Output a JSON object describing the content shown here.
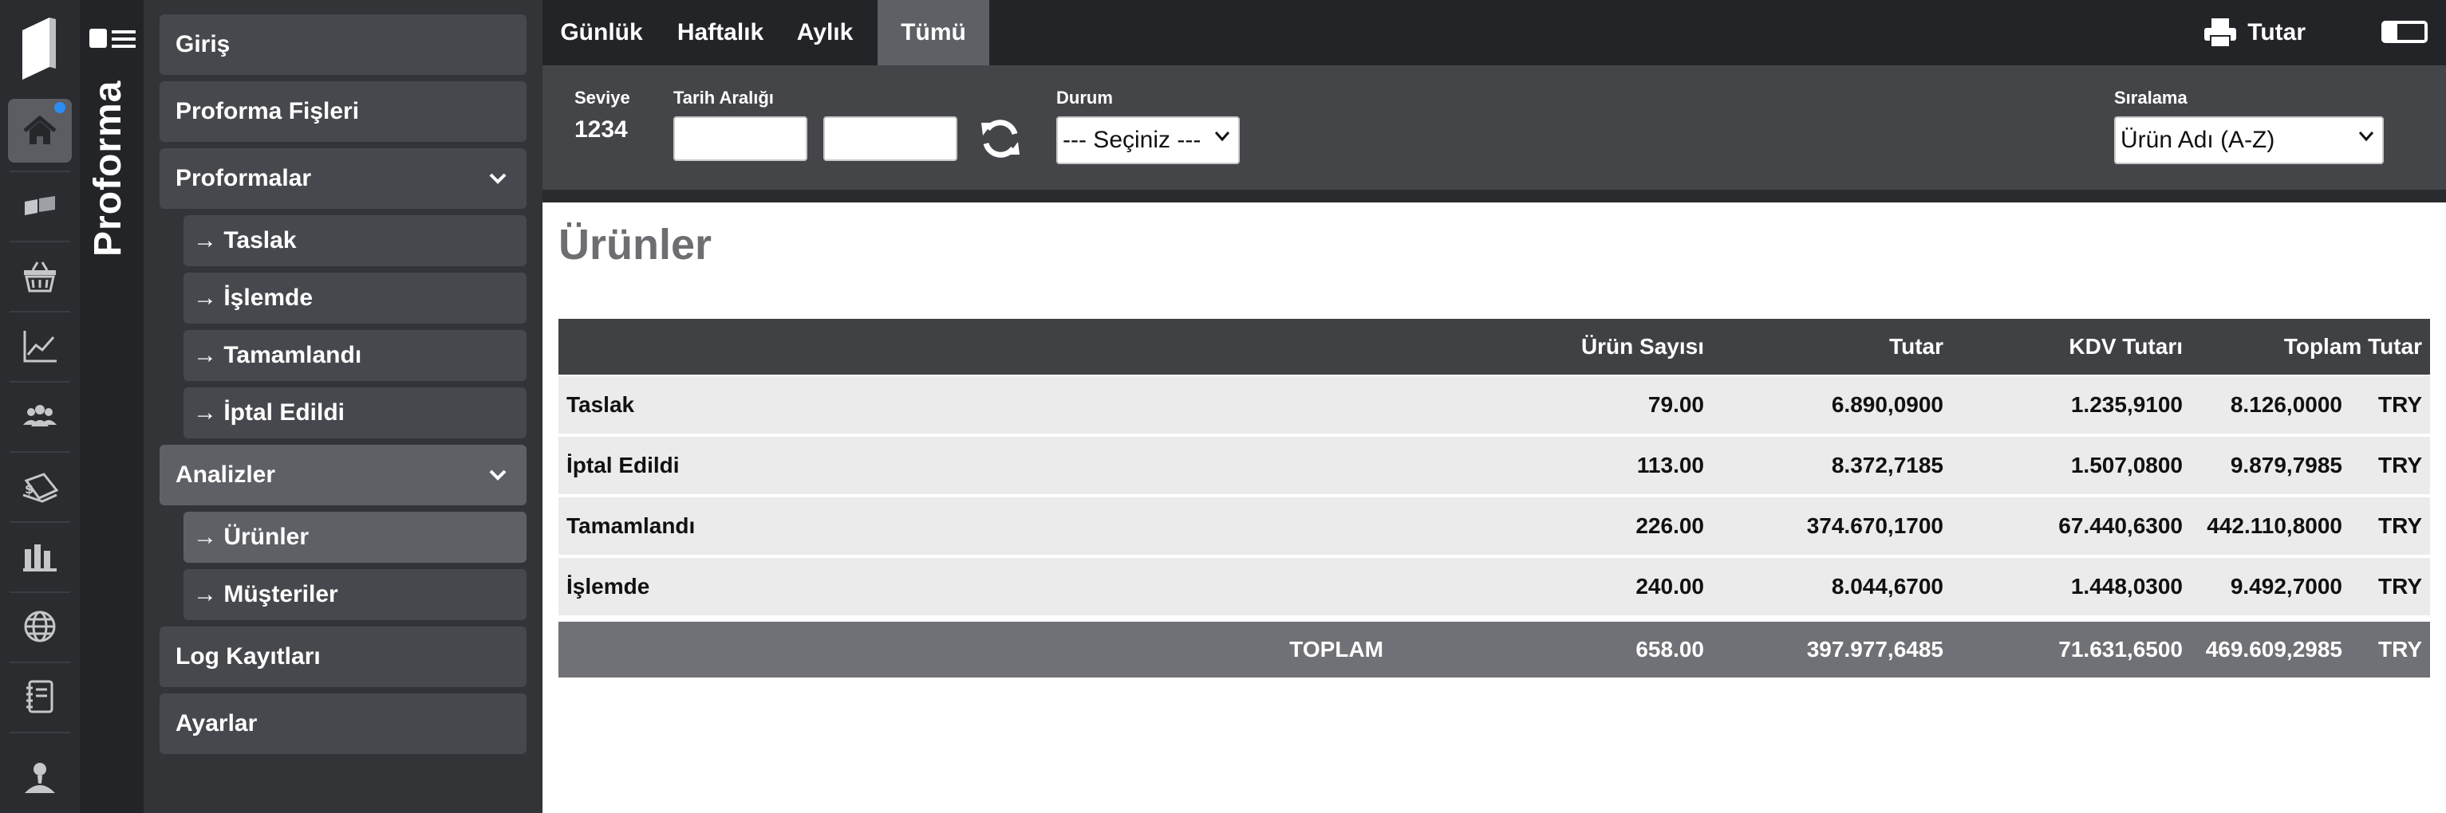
{
  "app": {
    "title": "Proforma",
    "accent_color": "#2d8cf0"
  },
  "rail": {
    "items": [
      {
        "icon": "home-icon",
        "active": true,
        "notification": true
      },
      {
        "icon": "tickets-icon"
      },
      {
        "icon": "basket-icon"
      },
      {
        "icon": "chart-line-icon"
      },
      {
        "icon": "users-group-icon"
      },
      {
        "icon": "money-bill-icon"
      },
      {
        "icon": "warehouse-icon"
      },
      {
        "icon": "globe-icon"
      },
      {
        "icon": "notebook-icon"
      },
      {
        "icon": "user-icon"
      }
    ]
  },
  "sidebar": {
    "home": "Giriş",
    "proforma_slips": "Proforma Fişleri",
    "proformas": "Proformalar",
    "draft": "→ Taslak",
    "in_process": "→ İşlemde",
    "completed": "→ Tamamlandı",
    "cancelled": "→ İptal Edildi",
    "analyses": "Analizler",
    "products": "→ Ürünler",
    "customers": "→ Müşteriler",
    "logs": "Log Kayıtları",
    "settings": "Ayarlar"
  },
  "tabs": {
    "daily": "Günlük",
    "weekly": "Haftalık",
    "monthly": "Aylık",
    "all": "Tümü",
    "active": "Tümü"
  },
  "toolbar": {
    "print_label": "Tutar"
  },
  "filters": {
    "level_label": "Seviye",
    "level_value": "1234",
    "date_range_label": "Tarih Aralığı",
    "date_from": "",
    "date_to": "",
    "status_label": "Durum",
    "status_value": "--- Seçiniz ---",
    "sort_label": "Sıralama",
    "sort_value": "Ürün Adı (A-Z)"
  },
  "main": {
    "title": "Ürünler",
    "columns": {
      "count": "Ürün Sayısı",
      "amount": "Tutar",
      "vat": "KDV Tutarı",
      "total": "Toplam Tutar"
    },
    "rows": [
      {
        "status": "Taslak",
        "count": "79.00",
        "amount": "6.890,0900",
        "vat": "1.235,9100",
        "total": "8.126,0000",
        "currency": "TRY"
      },
      {
        "status": "İptal Edildi",
        "count": "113.00",
        "amount": "8.372,7185",
        "vat": "1.507,0800",
        "total": "9.879,7985",
        "currency": "TRY"
      },
      {
        "status": "Tamamlandı",
        "count": "226.00",
        "amount": "374.670,1700",
        "vat": "67.440,6300",
        "total": "442.110,8000",
        "currency": "TRY"
      },
      {
        "status": "İşlemde",
        "count": "240.00",
        "amount": "8.044,6700",
        "vat": "1.448,0300",
        "total": "9.492,7000",
        "currency": "TRY"
      }
    ],
    "footer": {
      "label": "TOPLAM",
      "count": "658.00",
      "amount": "397.977,6485",
      "vat": "71.631,6500",
      "total": "469.609,2985",
      "currency": "TRY"
    }
  }
}
